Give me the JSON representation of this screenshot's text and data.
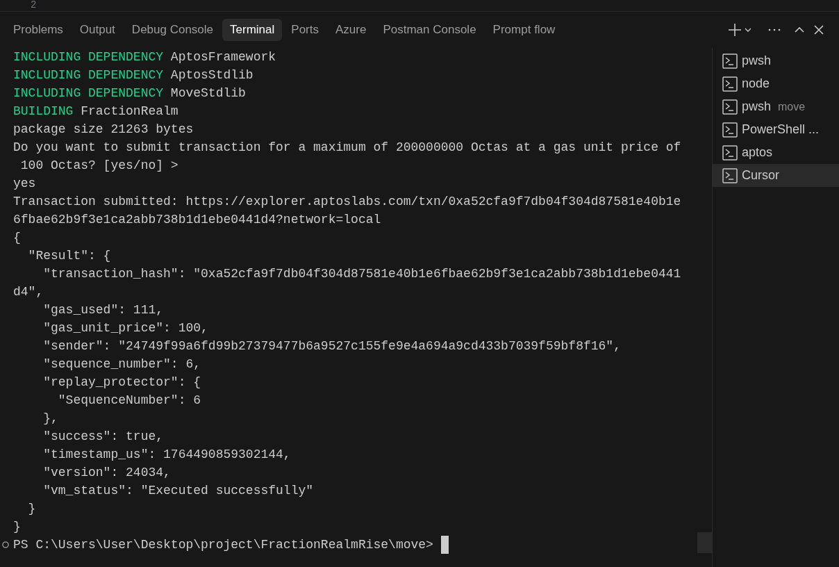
{
  "editor": {
    "line_number": "2"
  },
  "tabs": [
    {
      "label": "Problems",
      "selected": false
    },
    {
      "label": "Output",
      "selected": false
    },
    {
      "label": "Debug Console",
      "selected": false
    },
    {
      "label": "Terminal",
      "selected": true
    },
    {
      "label": "Ports",
      "selected": false
    },
    {
      "label": "Azure",
      "selected": false
    },
    {
      "label": "Postman Console",
      "selected": false
    },
    {
      "label": "Prompt flow",
      "selected": false
    }
  ],
  "terminal": {
    "lines": [
      {
        "keyword": "INCLUDING DEPENDENCY",
        "text": " AptosFramework"
      },
      {
        "keyword": "INCLUDING DEPENDENCY",
        "text": " AptosStdlib"
      },
      {
        "keyword": "INCLUDING DEPENDENCY",
        "text": " MoveStdlib"
      },
      {
        "keyword": "BUILDING",
        "text": " FractionRealm"
      },
      {
        "text": "package size 21263 bytes"
      },
      {
        "text": "Do you want to submit transaction for a maximum of 200000000 Octas at a gas unit price of"
      },
      {
        "text": " 100 Octas? [yes/no] >"
      },
      {
        "text": "yes"
      },
      {
        "text": "Transaction submitted: https://explorer.aptoslabs.com/txn/0xa52cfa9f7db04f304d87581e40b1e"
      },
      {
        "text": "6fbae62b9f3e1ca2abb738b1d1ebe0441d4?network=local"
      },
      {
        "text": "{"
      },
      {
        "text": "  \"Result\": {"
      },
      {
        "text": "    \"transaction_hash\": \"0xa52cfa9f7db04f304d87581e40b1e6fbae62b9f3e1ca2abb738b1d1ebe0441"
      },
      {
        "text": "d4\","
      },
      {
        "text": "    \"gas_used\": 111,"
      },
      {
        "text": "    \"gas_unit_price\": 100,"
      },
      {
        "text": "    \"sender\": \"24749f99a6fd99b27379477b6a9527c155fe9e4a694a9cd433b7039f59bf8f16\","
      },
      {
        "text": "    \"sequence_number\": 6,"
      },
      {
        "text": "    \"replay_protector\": {"
      },
      {
        "text": "      \"SequenceNumber\": 6"
      },
      {
        "text": "    },"
      },
      {
        "text": "    \"success\": true,"
      },
      {
        "text": "    \"timestamp_us\": 1764490859302144,"
      },
      {
        "text": "    \"version\": 24034,"
      },
      {
        "text": "    \"vm_status\": \"Executed successfully\""
      },
      {
        "text": "  }"
      },
      {
        "text": "}"
      }
    ],
    "prompt": "PS C:\\Users\\User\\Desktop\\project\\FractionRealmRise\\move>"
  },
  "sessions": [
    {
      "name": "pwsh",
      "selected": false
    },
    {
      "name": "node",
      "selected": false
    },
    {
      "name": "pwsh",
      "detail": "move",
      "selected": false
    },
    {
      "name": "PowerShell ...",
      "selected": false
    },
    {
      "name": "aptos",
      "selected": false
    },
    {
      "name": "Cursor",
      "selected": true
    }
  ]
}
